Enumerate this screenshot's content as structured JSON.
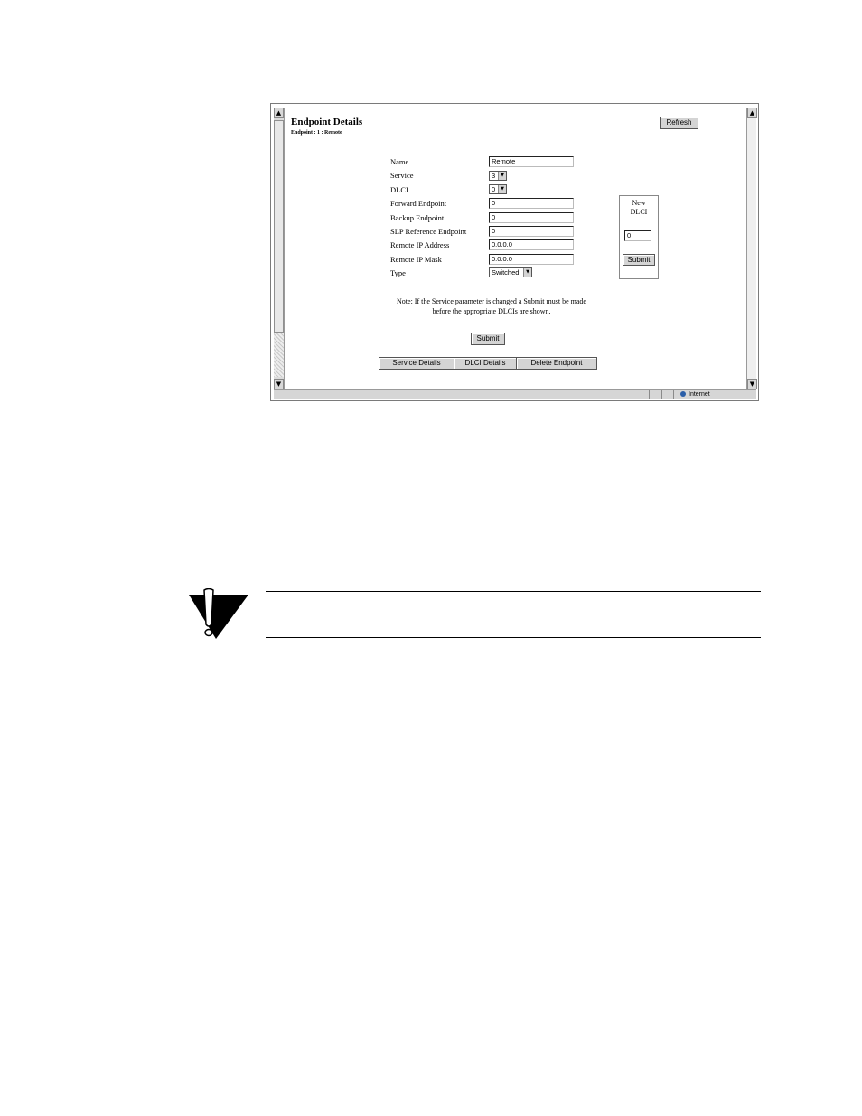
{
  "screenshot": {
    "page_title": "Endpoint Details",
    "page_subtitle": "Endpoint : 1 : Remote",
    "refresh_label": "Refresh",
    "form": {
      "name_label": "Name",
      "name_value": "Remote",
      "service_label": "Service",
      "service_value": "3",
      "dlci_label": "DLCI",
      "dlci_value": "0",
      "forward_label": "Forward Endpoint",
      "forward_value": "0",
      "backup_label": "Backup Endpoint",
      "backup_value": "0",
      "slp_label": "SLP Reference Endpoint",
      "slp_value": "0",
      "remote_ip_label": "Remote IP Address",
      "remote_ip_value": "0.0.0.0",
      "remote_mask_label": "Remote IP Mask",
      "remote_mask_value": "0.0.0.0",
      "type_label": "Type",
      "type_value": "Switched"
    },
    "new_dlci": {
      "heading_line1": "New",
      "heading_line2": "DLCI",
      "value": "0",
      "submit_label": "Submit"
    },
    "note_text": "Note:  If the Service parameter is changed a Submit must be made before the appropriate DLCIs are shown.",
    "submit_label": "Submit",
    "tabs": {
      "service_details": "Service Details",
      "dlci_details": "DLCI Details",
      "delete_endpoint": "Delete Endpoint"
    },
    "status_zone": "Internet"
  },
  "icons": {
    "scroll_up": "scroll-up-arrow-icon",
    "scroll_down": "scroll-down-arrow-icon",
    "dropdown": "dropdown-arrow-icon",
    "zone": "globe-icon",
    "caution": "caution-icon"
  }
}
